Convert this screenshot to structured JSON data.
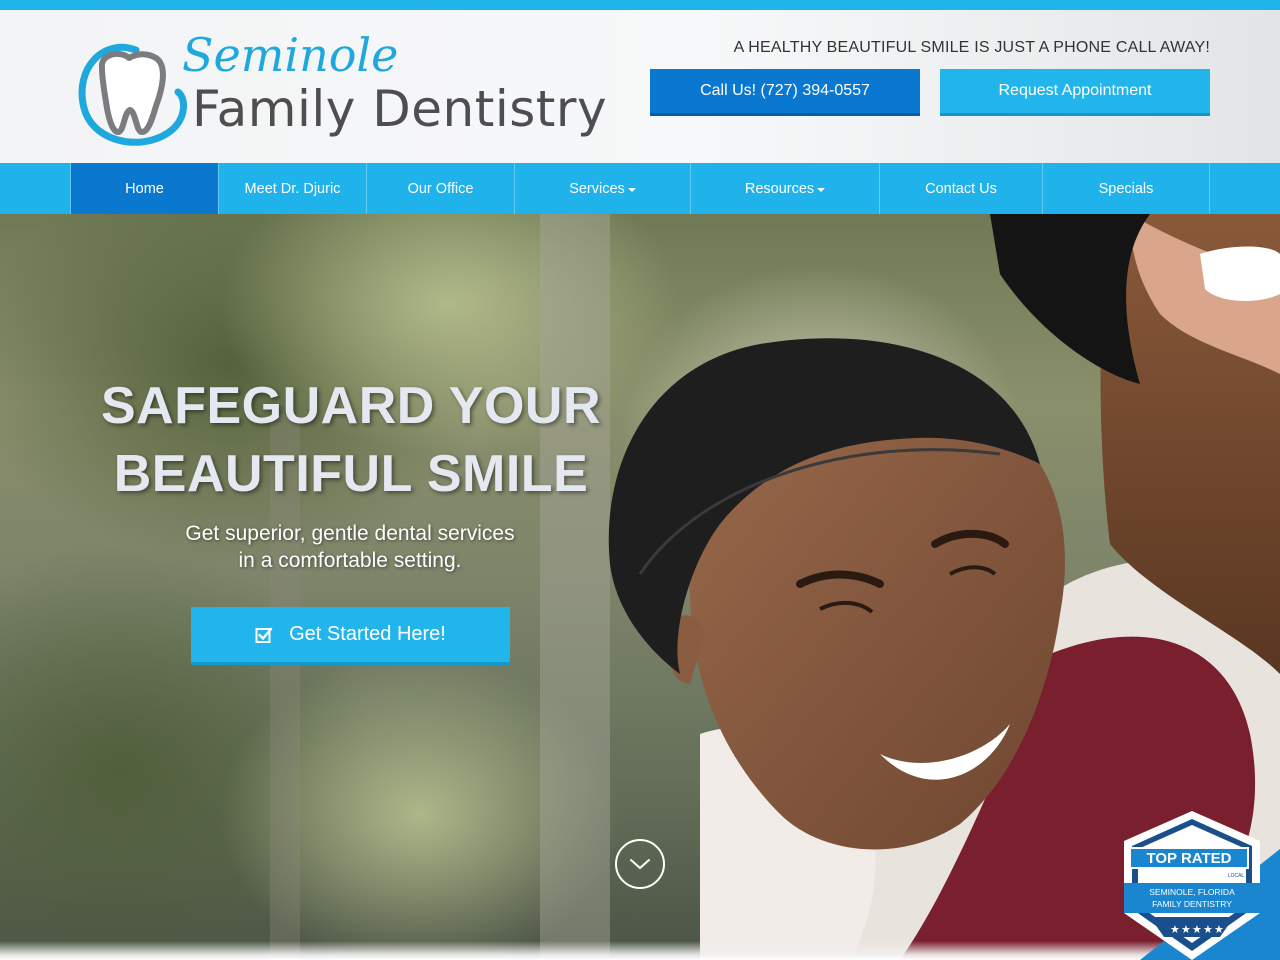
{
  "brand": {
    "script_name": "Seminole",
    "main_name": "Family Dentistry",
    "accent_color": "#20b2ea",
    "dark_accent_color": "#0b78cf"
  },
  "header": {
    "tagline": "A HEALTHY BEAUTIFUL SMILE IS JUST A PHONE CALL AWAY!",
    "call_button": "Call Us! (727) 394-0557",
    "appointment_button": "Request Appointment"
  },
  "nav": {
    "items": [
      {
        "label": "Home",
        "active": true,
        "dropdown": false
      },
      {
        "label": "Meet Dr. Djuric",
        "active": false,
        "dropdown": false
      },
      {
        "label": "Our Office",
        "active": false,
        "dropdown": false
      },
      {
        "label": "Services",
        "active": false,
        "dropdown": true
      },
      {
        "label": "Resources",
        "active": false,
        "dropdown": true
      },
      {
        "label": "Contact Us",
        "active": false,
        "dropdown": false
      },
      {
        "label": "Specials",
        "active": false,
        "dropdown": false
      }
    ]
  },
  "hero": {
    "title_line1": "SAFEGUARD YOUR",
    "title_line2": "BEAUTIFUL SMILE",
    "subtitle_line1": "Get superior, gentle dental services",
    "subtitle_line2": "in a comfortable setting.",
    "cta_label": "Get Started Here!",
    "cta_icon": "checkbox-icon",
    "scroll_icon": "chevron-down-icon"
  },
  "badge": {
    "title": "TOP RATED",
    "subtitle": "LOCAL",
    "line1": "SEMINOLE, FLORIDA",
    "line2": "FAMILY DENTISTRY",
    "stars": 5
  }
}
